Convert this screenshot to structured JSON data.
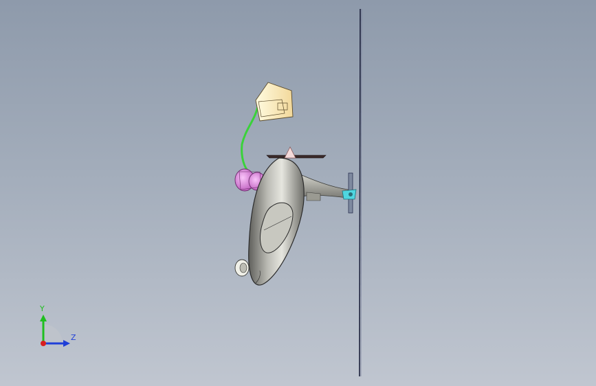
{
  "viewport": {
    "background_top": "#8e9aab",
    "background_bottom": "#c0c6d0"
  },
  "model": {
    "body_color": "#8c8c86",
    "canopy_outline": "#2a2a2a",
    "part_pink": "#e07ee0",
    "part_yellow": "#fff2b8",
    "part_green": "#3ad23a",
    "part_cyan": "#4fd6e0",
    "rotor_color": "#1a1f3a"
  },
  "triad": {
    "y_label": "Y",
    "z_label": "Z",
    "y_color": "#1fbf1f",
    "z_color": "#1f3fd8",
    "x_color": "#d81f1f"
  }
}
